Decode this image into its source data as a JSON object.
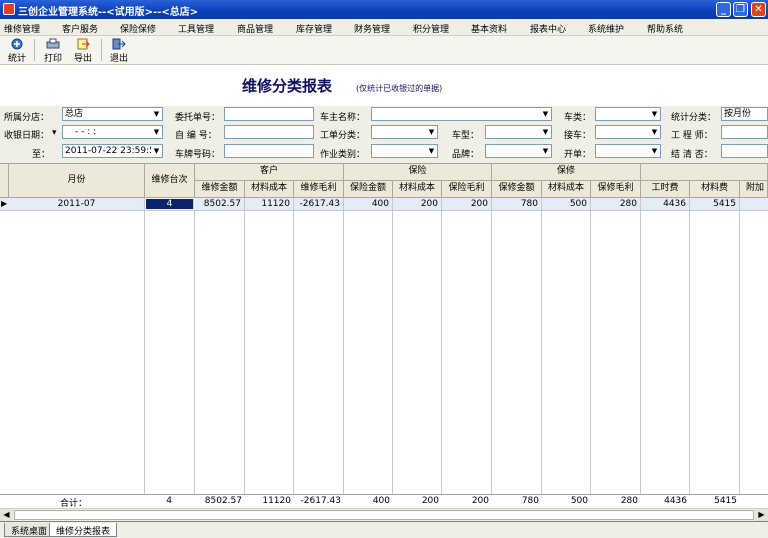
{
  "window": {
    "title": "三创企业管理系统--<试用版>--<总店>"
  },
  "menu": [
    "维修管理",
    "客户服务",
    "保险保修",
    "工具管理",
    "商品管理",
    "库存管理",
    "财务管理",
    "积分管理",
    "基本资料",
    "报表中心",
    "系统维护",
    "帮助系统"
  ],
  "toolbar": {
    "stats": "统计",
    "print": "打印",
    "export": "导出",
    "exit": "退出"
  },
  "report": {
    "title": "维修分类报表",
    "note": "(仅统计已收银过的单据)"
  },
  "filters": {
    "branch_label": "所属分店：",
    "branch_value": "总店",
    "date_from_label": "收银日期：",
    "date_from_value": "-  -    :  :",
    "date_to_label": "至：",
    "date_to_value": "2011-07-22 23:59:59",
    "commission_label": "委托单号：",
    "commission_value": "",
    "selfno_label": "自  编  号：",
    "selfno_value": "",
    "plate_label": "车牌号码：",
    "plate_value": "",
    "owner_label": "车主名称：",
    "owner_value": "",
    "ordertype_label": "工单分类：",
    "ordertype_value": "",
    "worktype_label": "作业类别：",
    "worktype_value": "",
    "cartype_label": "车类：",
    "cartype_value": "",
    "model_label": "车型：",
    "model_value": "",
    "brand_label": "品牌：",
    "brand_value": "",
    "pickup_label": "接车：",
    "pickup_value": "",
    "open_label": "开单：",
    "open_value": "",
    "statcat_label": "统计分类：",
    "statcat_value": "按月份",
    "engineer_label": "工  程  师：",
    "engineer_value": "",
    "settled_label": "结  清  否：",
    "settled_value": ""
  },
  "table": {
    "col_month": "月份",
    "col_count": "维修台次",
    "groups": {
      "customer": "客户",
      "insurance": "保险",
      "warranty": "保修"
    },
    "sub": {
      "c_amt": "维修金额",
      "c_mat": "材料成本",
      "c_gm": "维修毛利",
      "i_amt": "保险金额",
      "i_mat": "材料成本",
      "i_gm": "保险毛利",
      "w_amt": "保修金额",
      "w_mat": "材料成本",
      "w_gm": "保修毛利",
      "labor": "工时费",
      "material": "材料费",
      "extra": "附加"
    },
    "row": {
      "month": "2011-07",
      "count": "4",
      "c_amt": "8502.57",
      "c_mat": "11120",
      "c_gm": "-2617.43",
      "i_amt": "400",
      "i_mat": "200",
      "i_gm": "200",
      "w_amt": "780",
      "w_mat": "500",
      "w_gm": "280",
      "labor": "4436",
      "material": "5415"
    },
    "total": {
      "label": "合计：",
      "count": "4",
      "c_amt": "8502.57",
      "c_mat": "11120",
      "c_gm": "-2617.43",
      "i_amt": "400",
      "i_mat": "200",
      "i_gm": "200",
      "w_amt": "780",
      "w_mat": "500",
      "w_gm": "280",
      "labor": "4436",
      "material": "5415"
    }
  },
  "tabs": {
    "desktop": "系统桌面",
    "report": "维修分类报表"
  }
}
